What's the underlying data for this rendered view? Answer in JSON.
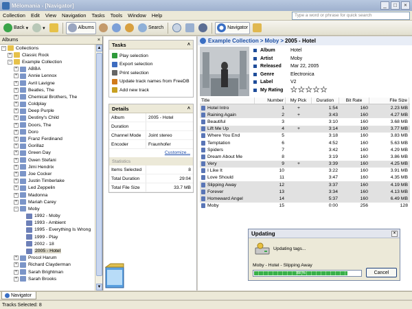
{
  "window": {
    "title": "Mélomania - [Navigator]"
  },
  "menu": [
    "Collection",
    "Edit",
    "View",
    "Navigation",
    "Tasks",
    "Tools",
    "Window",
    "Help"
  ],
  "quick_search": {
    "placeholder": "Type a word or phrase for quick search"
  },
  "toolbar": {
    "back": "Back",
    "albums": "Albums",
    "search": "Search",
    "navigator": "Navigator"
  },
  "left_panel": {
    "title": "Albums",
    "tree": [
      {
        "label": "Collections",
        "level": 0,
        "expander": "−"
      },
      {
        "label": "Classic Rock",
        "level": 1,
        "expander": "+"
      },
      {
        "label": "Example Collection",
        "level": 1,
        "expander": "−"
      },
      {
        "label": "ABBA",
        "level": 2,
        "expander": "+"
      },
      {
        "label": "Annie Lennox",
        "level": 2,
        "expander": "+"
      },
      {
        "label": "Avril Lavigne",
        "level": 2,
        "expander": "+"
      },
      {
        "label": "Beatles, The",
        "level": 2,
        "expander": "+"
      },
      {
        "label": "Chemical Brothers, The",
        "level": 2,
        "expander": "+"
      },
      {
        "label": "Coldplay",
        "level": 2,
        "expander": "+"
      },
      {
        "label": "Deep Purple",
        "level": 2,
        "expander": "+"
      },
      {
        "label": "Destiny's Child",
        "level": 2,
        "expander": "+"
      },
      {
        "label": "Doors, The",
        "level": 2,
        "expander": "+"
      },
      {
        "label": "Doro",
        "level": 2,
        "expander": "+"
      },
      {
        "label": "Franz Ferdinand",
        "level": 2,
        "expander": "+"
      },
      {
        "label": "Gorillaz",
        "level": 2,
        "expander": "+"
      },
      {
        "label": "Green Day",
        "level": 2,
        "expander": "+"
      },
      {
        "label": "Gwen Stefani",
        "level": 2,
        "expander": "+"
      },
      {
        "label": "Jimi Hendrix",
        "level": 2,
        "expander": "+"
      },
      {
        "label": "Joe Cocker",
        "level": 2,
        "expander": "+"
      },
      {
        "label": "Justin Timberlake",
        "level": 2,
        "expander": "+"
      },
      {
        "label": "Led Zeppelin",
        "level": 2,
        "expander": "+"
      },
      {
        "label": "Madonna",
        "level": 2,
        "expander": "+"
      },
      {
        "label": "Mariah Carey",
        "level": 2,
        "expander": "+"
      },
      {
        "label": "Moby",
        "level": 2,
        "expander": "−"
      },
      {
        "label": "1992 - Moby",
        "level": 3,
        "expander": ""
      },
      {
        "label": "1993 - Ambient",
        "level": 3,
        "expander": ""
      },
      {
        "label": "1995 - Everything Is Wrong",
        "level": 3,
        "expander": ""
      },
      {
        "label": "1999 - Play",
        "level": 3,
        "expander": ""
      },
      {
        "label": "2002 - 18",
        "level": 3,
        "expander": ""
      },
      {
        "label": "2005 - Hotel",
        "level": 3,
        "expander": "",
        "selected": true
      },
      {
        "label": "Procol Harum",
        "level": 2,
        "expander": "+"
      },
      {
        "label": "Richard Clayderman",
        "level": 2,
        "expander": "+"
      },
      {
        "label": "Sarah Brightman",
        "level": 2,
        "expander": "+"
      },
      {
        "label": "Sarah Brooks",
        "level": 2,
        "expander": "+"
      }
    ]
  },
  "tasks": {
    "title": "Tasks",
    "items": [
      {
        "label": "Play selection",
        "icon": "play-icon",
        "color": "#2e9a3a"
      },
      {
        "label": "Export selection",
        "icon": "export-icon",
        "color": "#3d6cc0"
      },
      {
        "label": "Print selection",
        "icon": "print-icon",
        "color": "#666666"
      },
      {
        "label": "Update track names from FreeDB",
        "icon": "freedb-icon",
        "color": "#d07a1a"
      },
      {
        "label": "Add new track",
        "icon": "add-track-icon",
        "color": "#c8a020"
      }
    ]
  },
  "details": {
    "title": "Details",
    "rows": [
      {
        "key": "Album",
        "value": "2005 - Hotel"
      },
      {
        "key": "Duration",
        "value": ""
      },
      {
        "key": "Channel Mode",
        "value": "Joint stereo"
      },
      {
        "key": "Encoder",
        "value": "Fraunhofer"
      }
    ],
    "customize": "Customize...",
    "statistics_title": "Statistics",
    "stats": [
      {
        "key": "Items Selected",
        "value": "8"
      },
      {
        "key": "Total Duration",
        "value": "29:04"
      },
      {
        "key": "Total File Size",
        "value": "33.7 MB"
      }
    ]
  },
  "breadcrumb": {
    "part1": "Example Collection",
    "sep1": ">",
    "part2": "Moby",
    "sep2": ">",
    "current": "2005 - Hotel"
  },
  "album_info": [
    {
      "key": "Album",
      "value": "Hotel"
    },
    {
      "key": "Artist",
      "value": "Moby"
    },
    {
      "key": "Released",
      "value": "Mar 22, 2005"
    },
    {
      "key": "Genre",
      "value": "Electronica"
    },
    {
      "key": "Label",
      "value": "V2"
    },
    {
      "key": "My Rating",
      "value": "",
      "stars": 0
    }
  ],
  "tracks": {
    "columns": [
      "Title",
      "Number",
      "My Pick",
      "Duration",
      "Bit Rate",
      "File Size"
    ],
    "rows": [
      {
        "title": "Hotel Intro",
        "number": "1",
        "pick": "+",
        "duration": "1:54",
        "bitrate": "160",
        "size": "2.23 MB",
        "selected": true
      },
      {
        "title": "Raining Again",
        "number": "2",
        "pick": "+",
        "duration": "3:43",
        "bitrate": "160",
        "size": "4.27 MB",
        "selected": true
      },
      {
        "title": "Beautiful",
        "number": "3",
        "pick": "",
        "duration": "3:10",
        "bitrate": "160",
        "size": "3.68 MB",
        "selected": false
      },
      {
        "title": "Lift Me Up",
        "number": "4",
        "pick": "+",
        "duration": "3:14",
        "bitrate": "160",
        "size": "3.77 MB",
        "selected": true
      },
      {
        "title": "Where You End",
        "number": "5",
        "pick": "",
        "duration": "3:18",
        "bitrate": "160",
        "size": "3.83 MB",
        "selected": false
      },
      {
        "title": "Temptation",
        "number": "6",
        "pick": "",
        "duration": "4:52",
        "bitrate": "160",
        "size": "5.63 MB",
        "selected": false
      },
      {
        "title": "Spiders",
        "number": "7",
        "pick": "",
        "duration": "3:42",
        "bitrate": "160",
        "size": "4.29 MB",
        "selected": false
      },
      {
        "title": "Dream About Me",
        "number": "8",
        "pick": "",
        "duration": "3:19",
        "bitrate": "160",
        "size": "3.86 MB",
        "selected": false
      },
      {
        "title": "Very",
        "number": "9",
        "pick": "+",
        "duration": "3:39",
        "bitrate": "160",
        "size": "4.25 MB",
        "selected": true
      },
      {
        "title": "I Like It",
        "number": "10",
        "pick": "",
        "duration": "3:22",
        "bitrate": "160",
        "size": "3.91 MB",
        "selected": false
      },
      {
        "title": "Love Should",
        "number": "11",
        "pick": "",
        "duration": "3:47",
        "bitrate": "160",
        "size": "4.35 MB",
        "selected": false
      },
      {
        "title": "Slipping Away",
        "number": "12",
        "pick": "",
        "duration": "3:37",
        "bitrate": "160",
        "size": "4.19 MB",
        "selected": true
      },
      {
        "title": "Forever",
        "number": "13",
        "pick": "",
        "duration": "3:34",
        "bitrate": "160",
        "size": "4.13 MB",
        "selected": true
      },
      {
        "title": "Homeward Angel",
        "number": "14",
        "pick": "",
        "duration": "5:37",
        "bitrate": "160",
        "size": "6.49 MB",
        "selected": true
      },
      {
        "title": "Moby",
        "number": "15",
        "pick": "",
        "duration": "0:00",
        "bitrate": "256",
        "size": "128",
        "selected": false
      }
    ]
  },
  "dialog": {
    "title": "Updating",
    "status": "Updating tags...",
    "track": "Moby - Hotel - Slipping Away",
    "progress_percent": 88,
    "progress_label": "88 %",
    "cancel": "Cancel"
  },
  "bottom_tab": {
    "label": "Navigator"
  },
  "status_bar": {
    "text": "Tracks Selected: 8"
  },
  "colors": {
    "accent": "#1d4fa3",
    "selected_row": "#e1e1e1",
    "progress": "#39b04a"
  }
}
